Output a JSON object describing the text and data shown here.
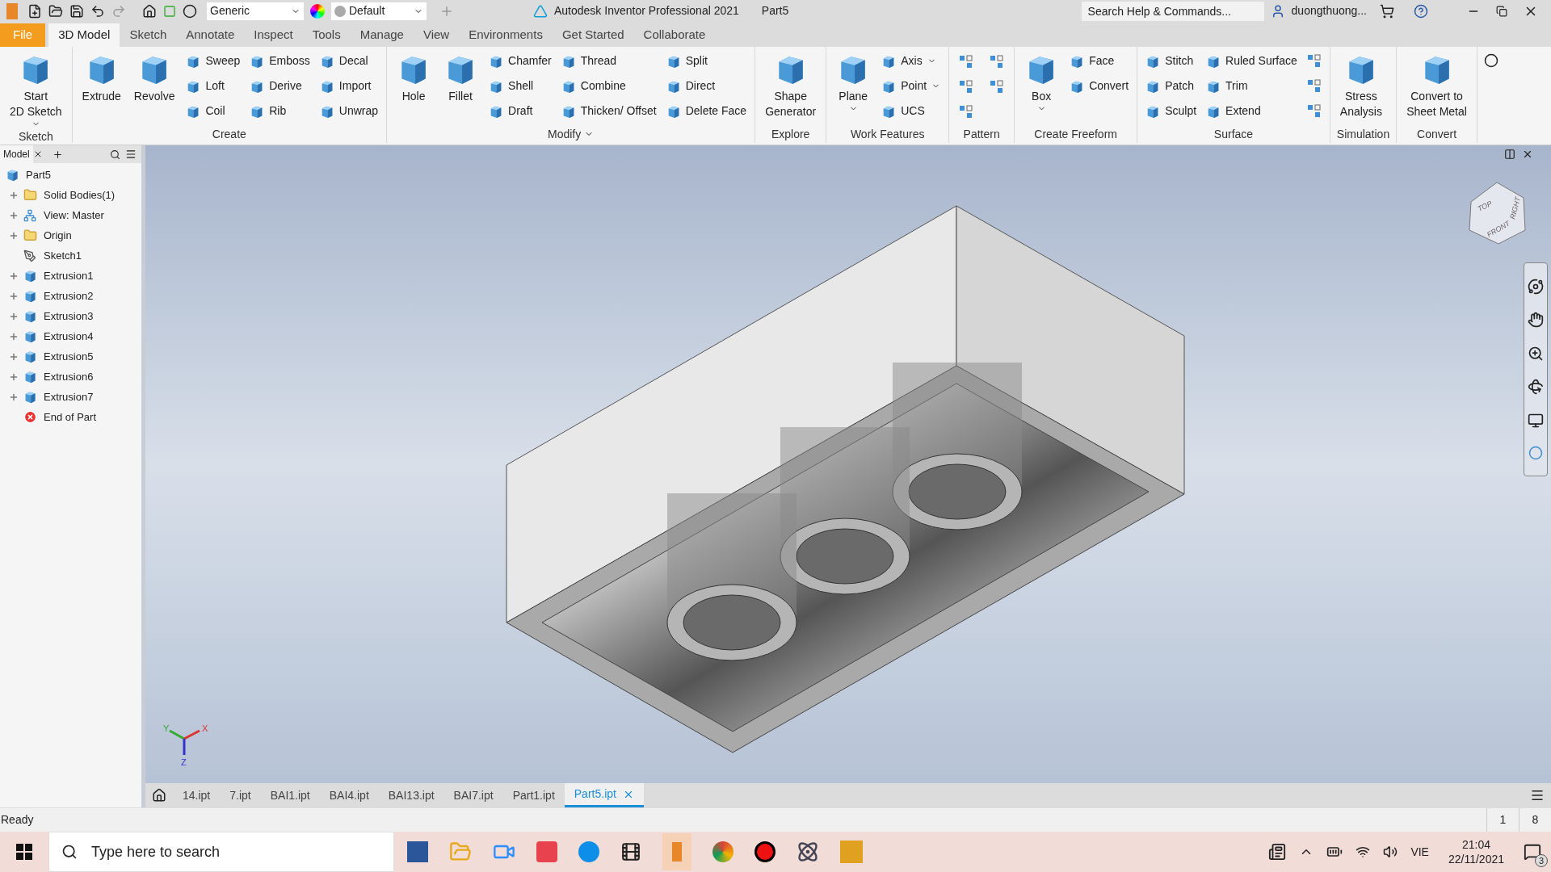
{
  "title_bar": {
    "material": "Generic",
    "appearance": "Default",
    "title": "Autodesk Inventor Professional 2021",
    "document": "Part5",
    "search": {
      "placeholder": "Search Help & Commands..."
    },
    "user": "duongthuong..."
  },
  "menu_tabs": [
    {
      "label": "File",
      "kind": "file",
      "selected": false
    },
    {
      "label": "3D Model",
      "kind": "tab",
      "selected": true
    },
    {
      "label": "Sketch",
      "kind": "tab",
      "selected": false
    },
    {
      "label": "Annotate",
      "kind": "tab",
      "selected": false
    },
    {
      "label": "Inspect",
      "kind": "tab",
      "selected": false
    },
    {
      "label": "Tools",
      "kind": "tab",
      "selected": false
    },
    {
      "label": "Manage",
      "kind": "tab",
      "selected": false
    },
    {
      "label": "View",
      "kind": "tab",
      "selected": false
    },
    {
      "label": "Environments",
      "kind": "tab",
      "selected": false
    },
    {
      "label": "Get Started",
      "kind": "tab",
      "selected": false
    },
    {
      "label": "Collaborate",
      "kind": "tab",
      "selected": false
    }
  ],
  "ribbon": [
    {
      "title": "Sketch",
      "kind": "tools",
      "menu": false,
      "large": [
        {
          "label": "Start\n2D Sketch",
          "dropdown": true
        }
      ]
    },
    {
      "title": "Create",
      "kind": "tools",
      "menu": false,
      "large": [
        {
          "label": "Extrude",
          "dropdown": false
        },
        {
          "label": "Revolve",
          "dropdown": false
        }
      ],
      "columns": [
        [
          {
            "label": "Sweep",
            "dropdown": false
          },
          {
            "label": "Loft",
            "dropdown": false
          },
          {
            "label": "Coil",
            "dropdown": false
          }
        ],
        [
          {
            "label": "Emboss",
            "dropdown": false
          },
          {
            "label": "Derive",
            "dropdown": false
          },
          {
            "label": "Rib",
            "dropdown": false
          }
        ],
        [
          {
            "label": "Decal",
            "dropdown": false
          },
          {
            "label": "Import",
            "dropdown": false
          },
          {
            "label": "Unwrap",
            "dropdown": false
          }
        ]
      ]
    },
    {
      "title": "Modify",
      "kind": "tools",
      "menu": true,
      "large": [
        {
          "label": "Hole",
          "dropdown": false
        },
        {
          "label": "Fillet",
          "dropdown": false
        }
      ],
      "columns": [
        [
          {
            "label": "Chamfer",
            "dropdown": false
          },
          {
            "label": "Shell",
            "dropdown": false
          },
          {
            "label": "Draft",
            "dropdown": false
          }
        ],
        [
          {
            "label": "Thread",
            "dropdown": false
          },
          {
            "label": "Combine",
            "dropdown": false
          },
          {
            "label": "Thicken/ Offset",
            "dropdown": false
          }
        ],
        [
          {
            "label": "Split",
            "dropdown": false
          },
          {
            "label": "Direct",
            "dropdown": false
          },
          {
            "label": "Delete Face",
            "dropdown": false
          }
        ]
      ]
    },
    {
      "title": "Explore",
      "kind": "tools",
      "menu": false,
      "large": [
        {
          "label": "Shape\nGenerator",
          "dropdown": false
        }
      ]
    },
    {
      "title": "Work Features",
      "kind": "tools",
      "menu": false,
      "large": [
        {
          "label": "Plane",
          "dropdown": true
        }
      ],
      "columns": [
        [
          {
            "label": "Axis",
            "dropdown": true
          },
          {
            "label": "Point",
            "dropdown": true
          },
          {
            "label": "UCS",
            "dropdown": false
          }
        ]
      ]
    },
    {
      "title": "Pattern",
      "kind": "icons",
      "menu": false
    },
    {
      "title": "Create Freeform",
      "kind": "tools",
      "menu": false,
      "large": [
        {
          "label": "Box",
          "dropdown": true
        }
      ],
      "columns": [
        [
          {
            "label": "Face",
            "dropdown": false
          },
          {
            "label": "Convert",
            "dropdown": false
          }
        ]
      ]
    },
    {
      "title": "Surface",
      "kind": "tools_icons",
      "menu": false,
      "columns": [
        [
          {
            "label": "Stitch",
            "dropdown": false
          },
          {
            "label": "Patch",
            "dropdown": false
          },
          {
            "label": "Sculpt",
            "dropdown": false
          }
        ],
        [
          {
            "label": "Ruled Surface",
            "dropdown": false
          },
          {
            "label": "Trim",
            "dropdown": false
          },
          {
            "label": "Extend",
            "dropdown": false
          }
        ]
      ]
    },
    {
      "title": "Simulation",
      "kind": "tools",
      "menu": false,
      "large": [
        {
          "label": "Stress\nAnalysis",
          "dropdown": false
        }
      ]
    },
    {
      "title": "Convert",
      "kind": "tools",
      "menu": false,
      "large": [
        {
          "label": "Convert to\nSheet Metal",
          "dropdown": false
        }
      ]
    }
  ],
  "browser": {
    "tab": "Model",
    "tree": {
      "label": "Part5",
      "kind": "part",
      "children": [
        {
          "label": "Solid Bodies(1)",
          "kind": "bodies",
          "collapsed": true
        },
        {
          "label": "View: Master",
          "kind": "view",
          "collapsed": true
        },
        {
          "label": "Origin",
          "kind": "folder",
          "collapsed": true
        },
        {
          "label": "Sketch1",
          "kind": "sketch",
          "collapsed": false
        },
        {
          "label": "Extrusion1",
          "kind": "extrusion",
          "collapsed": true
        },
        {
          "label": "Extrusion2",
          "kind": "extrusion",
          "collapsed": true
        },
        {
          "label": "Extrusion3",
          "kind": "extrusion",
          "collapsed": true
        },
        {
          "label": "Extrusion4",
          "kind": "extrusion",
          "collapsed": true
        },
        {
          "label": "Extrusion5",
          "kind": "extrusion",
          "collapsed": true
        },
        {
          "label": "Extrusion6",
          "kind": "extrusion",
          "collapsed": true
        },
        {
          "label": "Extrusion7",
          "kind": "extrusion",
          "collapsed": true
        },
        {
          "label": "End of Part",
          "kind": "end",
          "collapsed": false
        }
      ]
    }
  },
  "viewport": {
    "view_cube": [
      "TOP",
      "RIGHT",
      "FRONT"
    ],
    "axes": [
      "X",
      "Y",
      "Z"
    ]
  },
  "document_tabs": [
    {
      "label": "14.ipt",
      "selected": false
    },
    {
      "label": "7.ipt",
      "selected": false
    },
    {
      "label": "BAI1.ipt",
      "selected": false
    },
    {
      "label": "BAI4.ipt",
      "selected": false
    },
    {
      "label": "BAI13.ipt",
      "selected": false
    },
    {
      "label": "BAI7.ipt",
      "selected": false
    },
    {
      "label": "Part1.ipt",
      "selected": false
    },
    {
      "label": "Part5.ipt",
      "selected": true
    }
  ],
  "status_bar": {
    "message": "Ready",
    "cells": [
      "1",
      "8"
    ]
  },
  "taskbar": {
    "search": {
      "placeholder": "Type here to search"
    },
    "language": "VIE",
    "time": "21:04",
    "date": "22/11/2021",
    "notifications": "3"
  }
}
